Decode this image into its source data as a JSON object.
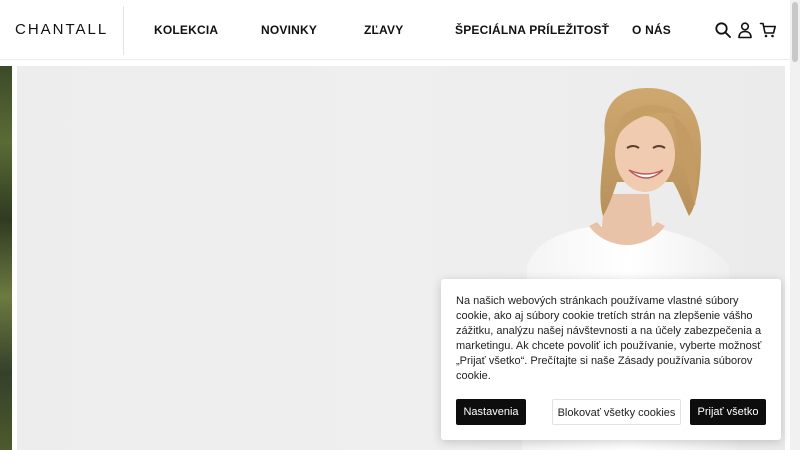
{
  "header": {
    "logo": "CHANTALL",
    "nav": [
      "KOLEKCIA",
      "NOVINKY",
      "ZĽAVY",
      "ŠPECIÁLNA PRÍLEŽITOSŤ",
      "O NÁS"
    ],
    "icons": [
      "search-icon",
      "user-icon",
      "cart-icon"
    ]
  },
  "cookie_banner": {
    "text": "Na našich webových stránkach používame vlastné súbory cookie, ako aj súbory cookie tretích strán na zlepšenie vášho zážitku, analýzu našej návštevnosti a na účely zabezpečenia a marketingu. Ak chcete povoliť ich používanie, vyberte možnosť „Prijať všetko“. Prečítajte si naše Zásady používania súborov cookie.",
    "settings_label": "Nastavenia",
    "block_label": "Blokovať všetky cookies",
    "accept_label": "Prijať všetko"
  }
}
